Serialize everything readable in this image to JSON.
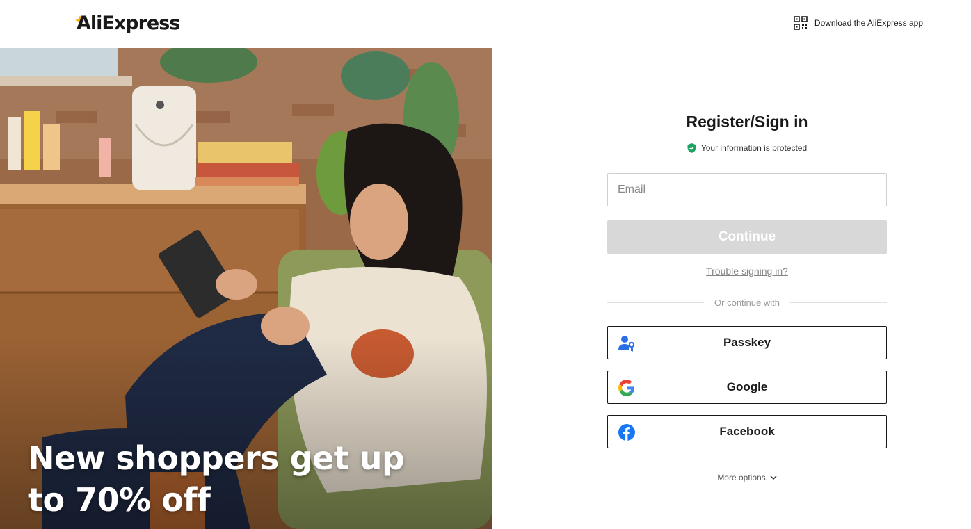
{
  "header": {
    "logo_text": "AliExpress",
    "app_download_label": "Download the AliExpress app"
  },
  "hero": {
    "headline": "New shoppers get up to 70% off"
  },
  "login": {
    "title": "Register/Sign in",
    "protected_text": "Your information is protected",
    "email_placeholder": "Email",
    "email_value": "",
    "continue_label": "Continue",
    "trouble_link": "Trouble signing in?",
    "divider_text": "Or continue with",
    "social_buttons": [
      {
        "label": "Passkey",
        "icon": "passkey-icon"
      },
      {
        "label": "Google",
        "icon": "google-icon"
      },
      {
        "label": "Facebook",
        "icon": "facebook-icon"
      }
    ],
    "more_options_label": "More options"
  },
  "colors": {
    "continue_disabled_bg": "#d8d8d8",
    "shield_green": "#1aa260",
    "passkey_blue": "#2a6ee8",
    "facebook_blue": "#1877f2",
    "logo_accent": "#f7b500"
  }
}
